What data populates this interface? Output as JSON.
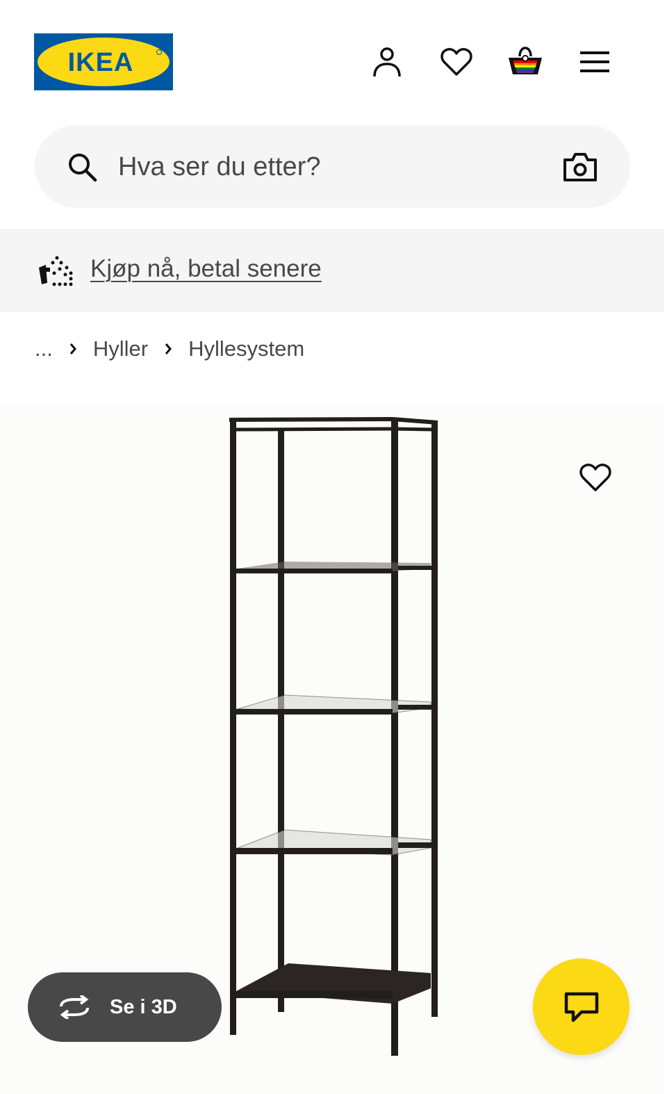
{
  "header": {
    "logo_text": "IKEA",
    "icons": [
      "profile-icon",
      "heart-icon",
      "basket-icon",
      "menu-icon"
    ]
  },
  "search": {
    "placeholder": "Hva ser du etter?",
    "icons": [
      "search-icon",
      "camera-icon"
    ]
  },
  "banner": {
    "link_text": "Kjøp nå, betal senere",
    "icon": "payment-icon"
  },
  "breadcrumb": {
    "ellipsis": "...",
    "items": [
      "Hyller",
      "Hyllesystem"
    ]
  },
  "product": {
    "view_3d_label": "Se i 3D",
    "icons": [
      "favorite-heart-icon",
      "rotate-3d-icon",
      "chat-icon"
    ]
  },
  "colors": {
    "ikea_blue": "#0058a3",
    "ikea_yellow": "#fbd914",
    "search_bg": "#f5f5f5",
    "banner_bg": "#f5f5f5",
    "button_dark": "#484848",
    "text_gray": "#484848",
    "icon_black": "#111111"
  }
}
